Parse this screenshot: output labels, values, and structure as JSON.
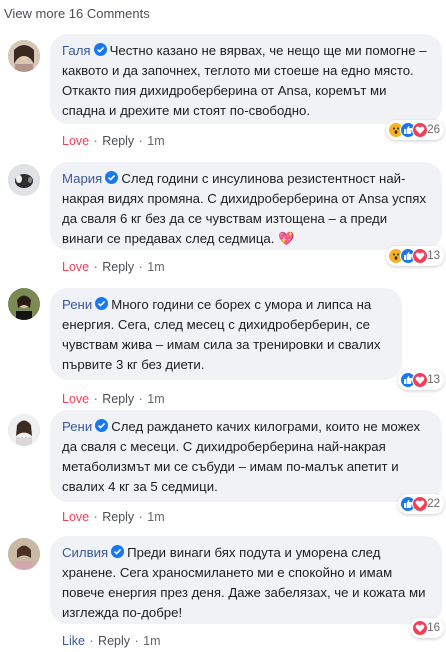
{
  "view_more": "View more 16 Comments",
  "comments": [
    {
      "author": "Галя",
      "text": "Честно казано не вярвах, че нещо ще ми помогне – каквото и да започнех, теглото ми стоеше на едно място. Откакто пия дихидроберберина от Ansa, коремът ми спадна и дрехите ми стоят по-свободно.",
      "emoji": "",
      "reaction_icons": [
        "wow-icon",
        "like-icon",
        "love-icon"
      ],
      "reaction_count": "26",
      "action": "Love",
      "reply": "Reply",
      "time": "1m"
    },
    {
      "author": "Мария",
      "text": "След години с инсулинова резистентност най-накрая видях промяна. С дихидроберберина от Ansa успях да сваля 6 кг без да се чувствам изтощена – а преди винаги се предавах след седмица.",
      "emoji": "💖",
      "reaction_icons": [
        "wow-icon",
        "like-icon",
        "love-icon"
      ],
      "reaction_count": "13",
      "action": "Love",
      "reply": "Reply",
      "time": "1m"
    },
    {
      "author": "Рени",
      "text": "Много години се борех с умора и липса на енергия. Сега, след месец с дихидроберберин, се чувствам жива – имам сила за тренировки и свалих първите 3 кг без диети.",
      "emoji": "",
      "reaction_icons": [
        "like-icon",
        "love-icon"
      ],
      "reaction_count": "13",
      "action": "Love",
      "reply": "Reply",
      "time": "1m"
    },
    {
      "author": "Рени",
      "text": "След раждането качих килограми, които не можех да сваля с месеци. С дихидроберберина най-накрая метаболизмът ми се събуди – имам по-малък апетит и свалих 4 кг за 5 седмици.",
      "emoji": "",
      "reaction_icons": [
        "like-icon",
        "love-icon"
      ],
      "reaction_count": "22",
      "action": "Love",
      "reply": "Reply",
      "time": "1m"
    },
    {
      "author": "Силвия",
      "text": "Преди винаги бях подута и уморена след хранене. Сега храносмилането ми е спокойно и имам повече енергия през деня. Даже забелязах, че и кожата ми изглежда по-добре!",
      "emoji": "",
      "reaction_icons": [
        "love-icon"
      ],
      "reaction_count": "16",
      "action": "Like",
      "reply": "Reply",
      "time": "1m"
    }
  ],
  "colors": {
    "author": "#385898",
    "love": "#f33e58",
    "like": "#1877f2",
    "wow": "#f7b125",
    "bubble": "#f0f2f5"
  }
}
